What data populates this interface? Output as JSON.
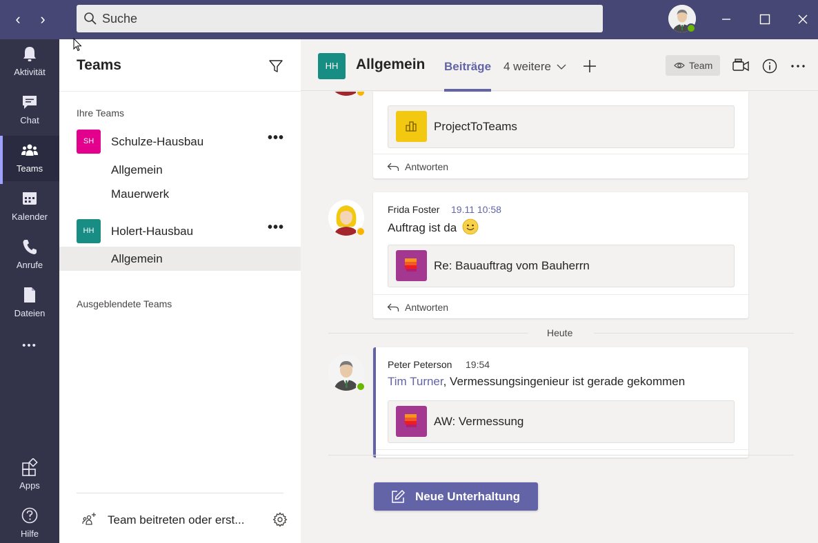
{
  "titlebar": {
    "back_glyph": "‹",
    "forward_glyph": "›",
    "search_placeholder": "Suche"
  },
  "rail": {
    "items": [
      {
        "label": "Aktivität",
        "icon": "bell-icon"
      },
      {
        "label": "Chat",
        "icon": "chat-icon"
      },
      {
        "label": "Teams",
        "icon": "teams-icon"
      },
      {
        "label": "Kalender",
        "icon": "calendar-icon"
      },
      {
        "label": "Anrufe",
        "icon": "phone-icon"
      },
      {
        "label": "Dateien",
        "icon": "file-icon"
      },
      {
        "label": "Apps",
        "icon": "apps-icon"
      },
      {
        "label": "Hilfe",
        "icon": "help-icon"
      }
    ],
    "more_glyph": "•••"
  },
  "panel": {
    "title": "Teams",
    "section_your_teams": "Ihre Teams",
    "teams": [
      {
        "initials": "SH",
        "name": "Schulze-Hausbau",
        "color": "#e3008c",
        "channels": [
          "Allgemein",
          "Mauerwerk"
        ]
      },
      {
        "initials": "HH",
        "name": "Holert-Hausbau",
        "color": "#178d84",
        "channels": [
          "Allgemein"
        ]
      }
    ],
    "more_glyph": "•••",
    "section_hidden": "Ausgeblendete Teams",
    "join_label": "Team beitreten oder erst..."
  },
  "channel": {
    "initials": "HH",
    "title": "Allgemein",
    "tab_active": "Beiträge",
    "tab_more": "4 weitere",
    "team_pill": "Team"
  },
  "messages": [
    {
      "attachment": "ProjectToTeams",
      "reply": "Antworten",
      "att_color": "#f2c811"
    },
    {
      "author": "Frida Foster",
      "time": "19.11 10:58",
      "text": "Auftrag ist da",
      "attachment": "Re: Bauauftrag vom Bauherrn",
      "reply": "Antworten",
      "att_color": "#a4378f"
    },
    {
      "author": "Peter Peterson",
      "time": "19:54",
      "mention": "Tim Turner",
      "text": ", Vermessungsingenieur ist gerade gekommen",
      "attachment": "AW: Vermessung",
      "att_color": "#a4378f"
    }
  ],
  "date_separator": "Heute",
  "new_conversation": "Neue Unterhaltung",
  "colors": {
    "brand": "#6264a7",
    "titlebar": "#464775",
    "rail": "#33344a",
    "online": "#6bb700",
    "away": "#f8b500"
  }
}
